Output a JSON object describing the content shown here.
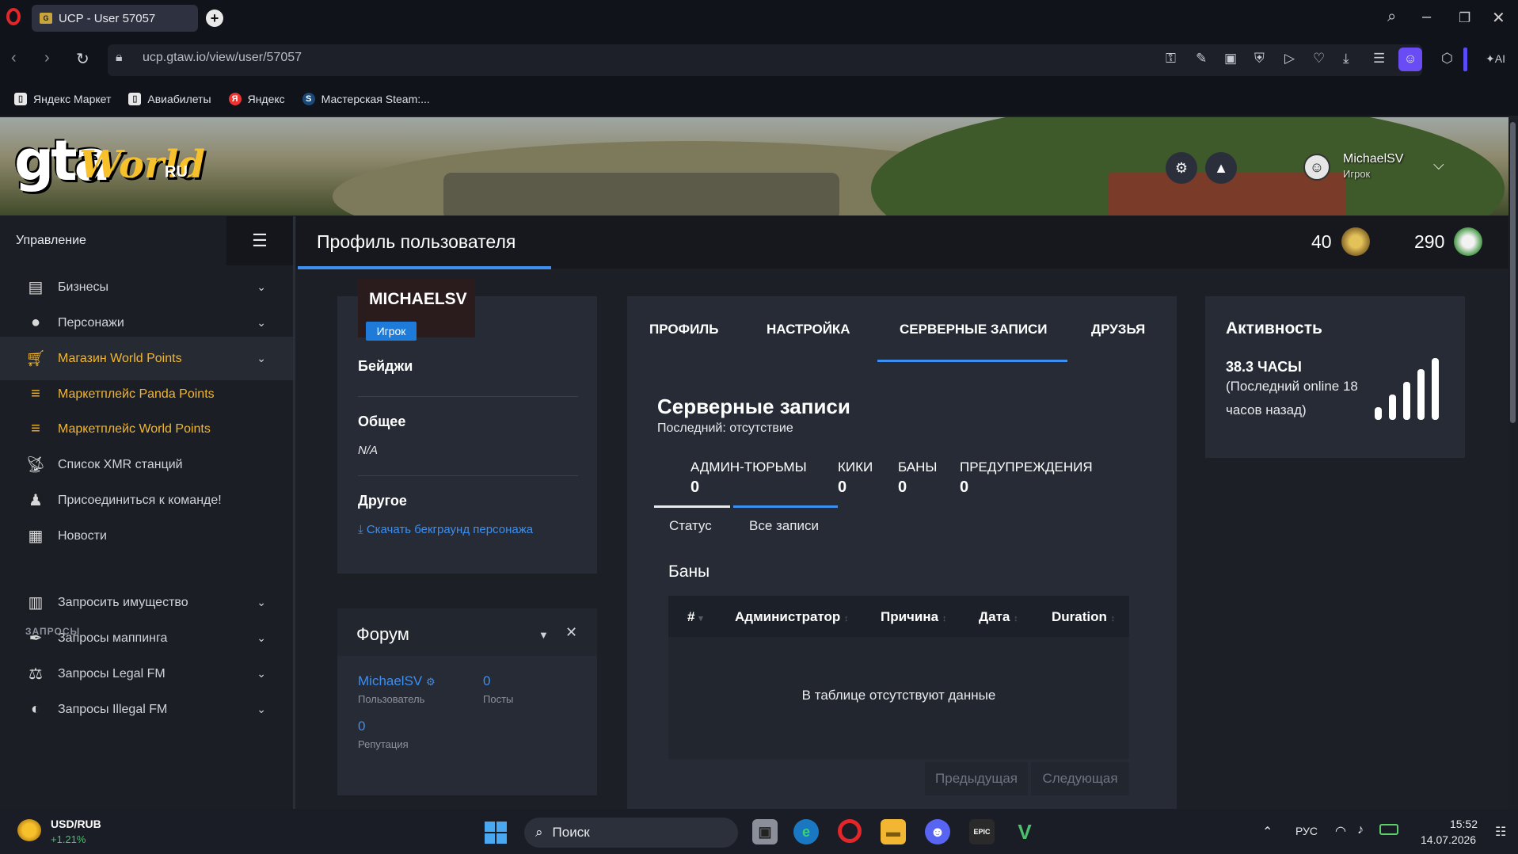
{
  "browser": {
    "tab_title": "UCP - User 57057",
    "url": "ucp.gtaw.io/view/user/57057",
    "bookmarks": [
      "Яндекс Маркет",
      "Авиабилеты",
      "Яндекс",
      "Мастерская Steam:..."
    ],
    "toolbar_right_label": "AI"
  },
  "banner": {
    "logo_main": "gta",
    "logo_world": "World",
    "logo_suffix": "RU",
    "user_name": "MichaelSV",
    "user_role": "Игрок"
  },
  "sidebar": {
    "header": "Управление",
    "items": [
      {
        "label": "Бизнесы",
        "icon": "briefcase-icon"
      },
      {
        "label": "Персонажи",
        "icon": "user-icon"
      },
      {
        "label": "Магазин World Points",
        "icon": "cart-icon"
      },
      {
        "label": "Маркетплейс Panda Points",
        "icon": "coins-icon"
      },
      {
        "label": "Маркетплейс World Points",
        "icon": "coins-icon"
      },
      {
        "label": "Список XMR станций",
        "icon": "antenna-icon"
      },
      {
        "label": "Присоединиться к команде!",
        "icon": "user-tie-icon"
      },
      {
        "label": "Новости",
        "icon": "newspaper-icon"
      }
    ],
    "group_label": "ЗАПРОСЫ",
    "request_items": [
      {
        "label": "Запросить имущество",
        "icon": "building-icon"
      },
      {
        "label": "Запросы маппинга",
        "icon": "brush-icon"
      },
      {
        "label": "Запросы Legal FM",
        "icon": "scales-icon"
      },
      {
        "label": "Запросы Illegal FM",
        "icon": "mask-icon"
      }
    ]
  },
  "header": {
    "title": "Профиль пользователя",
    "counter_1": "40",
    "counter_2": "290"
  },
  "profile": {
    "name": "MICHAELSV",
    "role_badge": "Игрок",
    "badges_label": "Бейджи",
    "general_label": "Общее",
    "general_value": "N/A",
    "other_label": "Другое",
    "download_link": "Скачать бекграунд персонажа"
  },
  "forum": {
    "title": "Форум",
    "user": "MichaelSV",
    "user_sub": "Пользователь",
    "posts_value": "0",
    "posts_label": "Посты",
    "rep_value": "0",
    "rep_label": "Репутация"
  },
  "main": {
    "tabs": [
      "ПРОФИЛЬ",
      "НАСТРОЙКА",
      "СЕРВЕРНЫЕ ЗАПИСИ",
      "ДРУЗЬЯ"
    ],
    "section_title": "Серверные записи",
    "section_sub": "Последний: отсутствие",
    "stats": [
      {
        "label": "АДМИН-ТЮРЬМЫ",
        "value": "0"
      },
      {
        "label": "КИКИ",
        "value": "0"
      },
      {
        "label": "БАНЫ",
        "value": "0"
      },
      {
        "label": "ПРЕДУПРЕЖДЕНИЯ",
        "value": "0"
      }
    ],
    "subtabs": [
      "Статус",
      "Все записи"
    ],
    "bans_title": "Баны",
    "table_headers": [
      "#",
      "Администратор",
      "Причина",
      "Дата",
      "Duration"
    ],
    "empty_text": "В таблице отсутствуют данные",
    "prev": "Предыдущая",
    "next": "Следующая"
  },
  "activity": {
    "title": "Активность",
    "hours": "38.3 ЧАСЫ",
    "line1": "(Последний online 18",
    "line2": "часов назад)"
  },
  "taskbar": {
    "ticker": "USD/RUB",
    "change": "+1.21%",
    "search": "Поиск",
    "lang": "РУС",
    "time": "15:52",
    "date": "14.07.2026"
  }
}
